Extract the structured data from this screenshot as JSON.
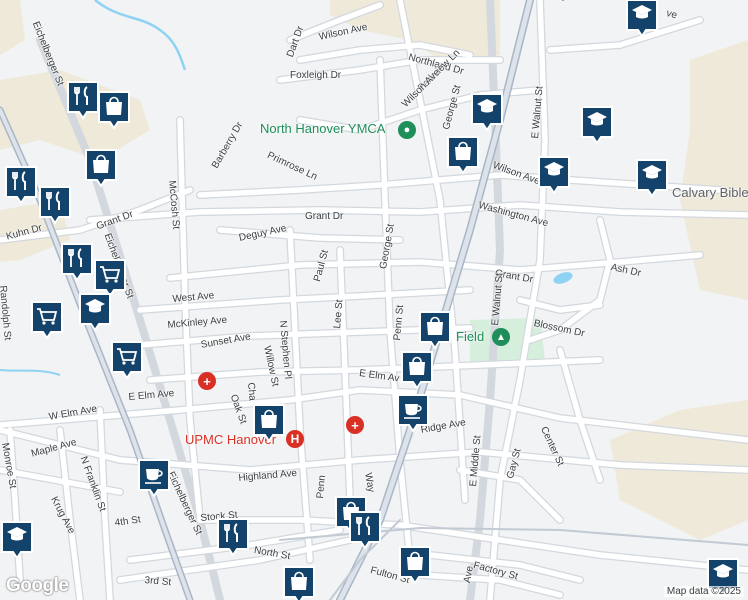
{
  "colors": {
    "background": "#f1f3f4",
    "road": "#ffffff",
    "road_casing": "#d3d8de",
    "highway": "#aab6c6",
    "rail": "#8b98a8",
    "green": "#cdebd5",
    "water": "#8fd3f4",
    "land_tan": "#efe9d9",
    "marker": "#13436b",
    "poi_green": "#1e8e5a",
    "hospital": "#d93025"
  },
  "streets": [
    {
      "id": "wilson-ave-n",
      "text": "Wilson Ave"
    },
    {
      "id": "dart-dr",
      "text": "Dart Dr"
    },
    {
      "id": "eichelberger-st-n",
      "text": "Eichelberger St"
    },
    {
      "id": "foxleigh-dr",
      "text": "Foxleigh Dr"
    },
    {
      "id": "northland-dr",
      "text": "Northland Dr"
    },
    {
      "id": "parkview-ln",
      "text": "Parkview Ln"
    },
    {
      "id": "wilson-ave-mid",
      "text": "Wilson Ave"
    },
    {
      "id": "george-st-n",
      "text": "George St"
    },
    {
      "id": "e-walnut-st-n",
      "text": "E Walnut St"
    },
    {
      "id": "barberry-dr",
      "text": "Barberry Dr"
    },
    {
      "id": "primrose-ln",
      "text": "Primrose Ln"
    },
    {
      "id": "wilson-ave-e",
      "text": "Wilson Ave"
    },
    {
      "id": "mccosh-st",
      "text": "McCosh St"
    },
    {
      "id": "kuhn-dr",
      "text": "Kuhn Dr"
    },
    {
      "id": "grant-dr-w",
      "text": "Grant Dr"
    },
    {
      "id": "grant-dr",
      "text": "Grant Dr"
    },
    {
      "id": "washington-ave",
      "text": "Washington Ave"
    },
    {
      "id": "deguy-ave",
      "text": "Deguy Ave"
    },
    {
      "id": "george-st",
      "text": "George St"
    },
    {
      "id": "randolph-st",
      "text": "Randolph St"
    },
    {
      "id": "eichelberger-st",
      "text": "Eichelberger St"
    },
    {
      "id": "paul-st",
      "text": "Paul St"
    },
    {
      "id": "grant-dr-e",
      "text": "Grant Dr"
    },
    {
      "id": "e-walnut-st",
      "text": "E Walnut St"
    },
    {
      "id": "ash-dr",
      "text": "Ash Dr"
    },
    {
      "id": "west-ave",
      "text": "West Ave"
    },
    {
      "id": "lee-st",
      "text": "Lee St"
    },
    {
      "id": "penn-st",
      "text": "Penn St"
    },
    {
      "id": "mckinley-ave",
      "text": "McKinley Ave"
    },
    {
      "id": "blossom-dr",
      "text": "Blossom Dr"
    },
    {
      "id": "sunset-ave",
      "text": "Sunset Ave"
    },
    {
      "id": "n-stephen-pl",
      "text": "N Stephen Pl"
    },
    {
      "id": "willow-st",
      "text": "Willow St"
    },
    {
      "id": "e-elm-ave-w",
      "text": "E Elm Ave"
    },
    {
      "id": "e-elm-ave",
      "text": "E Elm Av"
    },
    {
      "id": "cha",
      "text": "Cha"
    },
    {
      "id": "oak-st",
      "text": "Oak St"
    },
    {
      "id": "w-elm-ave",
      "text": "W Elm Ave"
    },
    {
      "id": "ridge-ave",
      "text": "Ridge Ave"
    },
    {
      "id": "center-st",
      "text": "Center St"
    },
    {
      "id": "maple-ave",
      "text": "Maple Ave"
    },
    {
      "id": "n-franklin-st",
      "text": "N Franklin St"
    },
    {
      "id": "monroe-st",
      "text": "Monroe St"
    },
    {
      "id": "e-middle-st",
      "text": "E Middle St"
    },
    {
      "id": "gay-st",
      "text": "Gay St"
    },
    {
      "id": "highland-ave",
      "text": "Highland Ave"
    },
    {
      "id": "krug-ave",
      "text": "Krug Ave"
    },
    {
      "id": "eichelberger-st-s",
      "text": "Eichelberger St"
    },
    {
      "id": "4th-st",
      "text": "4th St"
    },
    {
      "id": "stock-st",
      "text": "Stock St"
    },
    {
      "id": "way",
      "text": "Way"
    },
    {
      "id": "penn-s",
      "text": "Penn"
    },
    {
      "id": "north-st",
      "text": "North St"
    },
    {
      "id": "factory-st",
      "text": "Factory St"
    },
    {
      "id": "fulton-st",
      "text": "Fulton St"
    },
    {
      "id": "3rd-st",
      "text": "3rd St"
    },
    {
      "id": "ave-s",
      "text": "Ave"
    },
    {
      "id": "e-top",
      "text": "E"
    },
    {
      "id": "ave-top",
      "text": "ve"
    }
  ],
  "places": {
    "ymca": "North Hanover YMCA",
    "field": "Field",
    "upmc": "UPMC Hanover",
    "calvary": "Calvary Bible"
  },
  "markers": [
    {
      "type": "school"
    },
    {
      "type": "restaurant"
    },
    {
      "type": "shopping"
    },
    {
      "type": "school"
    },
    {
      "type": "school"
    },
    {
      "type": "shopping"
    },
    {
      "type": "shopping"
    },
    {
      "type": "school"
    },
    {
      "type": "school"
    },
    {
      "type": "restaurant"
    },
    {
      "type": "restaurant"
    },
    {
      "type": "restaurant"
    },
    {
      "type": "grocery"
    },
    {
      "type": "grocery"
    },
    {
      "type": "school"
    },
    {
      "type": "shopping"
    },
    {
      "type": "grocery"
    },
    {
      "type": "shopping"
    },
    {
      "type": "cafe"
    },
    {
      "type": "shopping"
    },
    {
      "type": "cafe"
    },
    {
      "type": "restaurant"
    },
    {
      "type": "shopping"
    },
    {
      "type": "restaurant"
    },
    {
      "type": "school"
    },
    {
      "type": "shopping"
    },
    {
      "type": "shopping"
    },
    {
      "type": "school"
    }
  ],
  "hospital_icons": [
    {
      "type": "hospital"
    },
    {
      "type": "hospital"
    },
    {
      "type": "hospital"
    }
  ],
  "attribution": "Map data ©2025",
  "logo_text": "Google"
}
